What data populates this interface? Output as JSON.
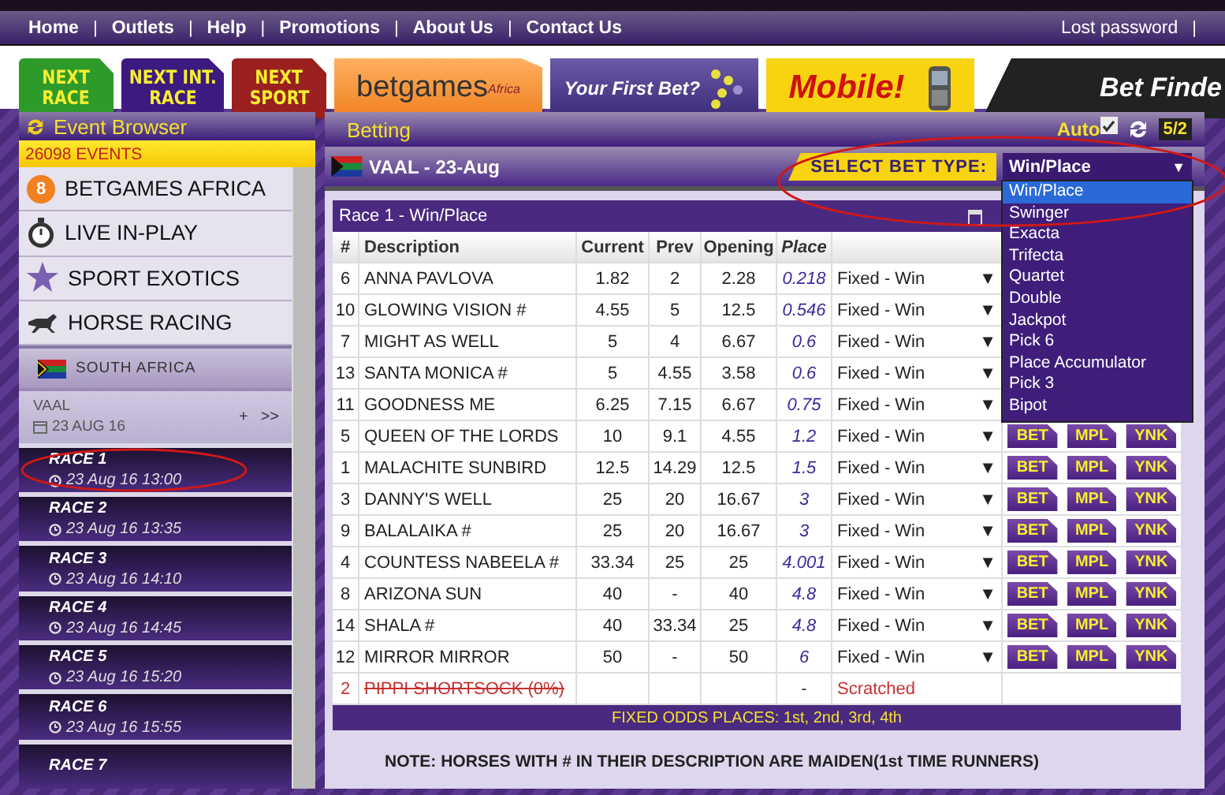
{
  "nav": {
    "links": [
      "Home",
      "Outlets",
      "Help",
      "Promotions",
      "About Us",
      "Contact Us"
    ],
    "separator": "|",
    "right_link": "Lost password"
  },
  "banners": [
    {
      "kind": "next",
      "lines": [
        "NEXT",
        "RACE"
      ],
      "color": "#2e9a2a"
    },
    {
      "kind": "next",
      "lines": [
        "NEXT INT.",
        "RACE"
      ],
      "color": "#3c1a80"
    },
    {
      "kind": "next",
      "lines": [
        "NEXT",
        "SPORT"
      ],
      "color": "#9a2020"
    },
    {
      "kind": "betgames",
      "lines": [
        "betgames",
        "Africa"
      ]
    },
    {
      "kind": "firstbet",
      "lines": [
        "Your First Bet?"
      ]
    },
    {
      "kind": "mobile",
      "lines": [
        "Mobile!"
      ]
    },
    {
      "kind": "finder",
      "lines": [
        "Bet Finde"
      ]
    }
  ],
  "sidebar": {
    "title": "Event Browser",
    "events": "26098 EVENTS",
    "categories": [
      {
        "label": "BETGAMES AFRICA",
        "kind": "ball",
        "badge": "8"
      },
      {
        "label": "LIVE IN-PLAY",
        "kind": "stopwatch"
      },
      {
        "label": "SPORT EXOTICS",
        "kind": "star"
      },
      {
        "label": "HORSE RACING",
        "kind": "horse"
      }
    ],
    "region": "SOUTH AFRICA",
    "meeting": {
      "name": "VAAL",
      "date": "23 AUG 16",
      "expand": "+",
      "go": ">>"
    },
    "races": [
      {
        "name": "RACE 1",
        "time": "23 Aug 16 13:00"
      },
      {
        "name": "RACE 2",
        "time": "23 Aug 16 13:35"
      },
      {
        "name": "RACE 3",
        "time": "23 Aug 16 14:10"
      },
      {
        "name": "RACE 4",
        "time": "23 Aug 16 14:45"
      },
      {
        "name": "RACE 5",
        "time": "23 Aug 16 15:20"
      },
      {
        "name": "RACE 6",
        "time": "23 Aug 16 15:55"
      },
      {
        "name": "RACE 7"
      }
    ]
  },
  "main": {
    "title": "Betting",
    "auto": {
      "label": "Auto",
      "checked": true
    },
    "odds_format": "5/2",
    "meeting": "VAAL - 23-Aug",
    "bet_type": {
      "label": "SELECT BET TYPE:",
      "value": "Win/Place",
      "arrow": "▼",
      "expanded": true,
      "options": [
        {
          "label": "Win/Place",
          "selected": true
        },
        {
          "label": "Swinger",
          "selected": false
        },
        {
          "label": "Exacta",
          "selected": false
        },
        {
          "label": "Trifecta",
          "selected": false
        },
        {
          "label": "Quartet",
          "selected": false
        },
        {
          "label": "Double",
          "selected": false
        },
        {
          "label": "Jackpot",
          "selected": false
        },
        {
          "label": "Pick 6",
          "selected": false
        },
        {
          "label": "Place Accumulator",
          "selected": false
        },
        {
          "label": "Pick 3",
          "selected": false
        },
        {
          "label": "Bipot",
          "selected": false
        }
      ]
    },
    "race_title": "Race 1 - Win/Place",
    "columns": [
      "#",
      "Description",
      "Current",
      "Prev",
      "Opening",
      "Place"
    ],
    "rows": [
      {
        "kind": "runner",
        "num": "6",
        "name": "ANNA PAVLOVA",
        "current": "1.82",
        "prev": "2",
        "opening": "2.28",
        "place": "0.218",
        "bet_type": "Fixed - Win",
        "arrow": "▼"
      },
      {
        "kind": "runner",
        "num": "10",
        "name": "GLOWING VISION #",
        "current": "4.55",
        "prev": "5",
        "opening": "12.5",
        "place": "0.546",
        "bet_type": "Fixed - Win",
        "arrow": "▼"
      },
      {
        "kind": "runner",
        "num": "7",
        "name": "MIGHT AS WELL",
        "current": "5",
        "prev": "4",
        "opening": "6.67",
        "place": "0.6",
        "bet_type": "Fixed - Win",
        "arrow": "▼"
      },
      {
        "kind": "runner",
        "num": "13",
        "name": "SANTA MONICA #",
        "current": "5",
        "prev": "4.55",
        "opening": "3.58",
        "place": "0.6",
        "bet_type": "Fixed - Win",
        "arrow": "▼"
      },
      {
        "kind": "runner",
        "num": "11",
        "name": "GOODNESS ME",
        "current": "6.25",
        "prev": "7.15",
        "opening": "6.67",
        "place": "0.75",
        "bet_type": "Fixed - Win",
        "arrow": "▼"
      },
      {
        "kind": "runner",
        "num": "5",
        "name": "QUEEN OF THE LORDS",
        "current": "10",
        "prev": "9.1",
        "opening": "4.55",
        "place": "1.2",
        "bet_type": "Fixed - Win",
        "arrow": "▼",
        "actions": [
          "BET",
          "MPL",
          "YNK"
        ]
      },
      {
        "kind": "runner",
        "num": "1",
        "name": "MALACHITE SUNBIRD",
        "current": "12.5",
        "prev": "14.29",
        "opening": "12.5",
        "place": "1.5",
        "bet_type": "Fixed - Win",
        "arrow": "▼",
        "actions": [
          "BET",
          "MPL",
          "YNK"
        ]
      },
      {
        "kind": "runner",
        "num": "3",
        "name": "DANNY'S WELL",
        "current": "25",
        "prev": "20",
        "opening": "16.67",
        "place": "3",
        "bet_type": "Fixed - Win",
        "arrow": "▼",
        "actions": [
          "BET",
          "MPL",
          "YNK"
        ]
      },
      {
        "kind": "runner",
        "num": "9",
        "name": "BALALAIKA #",
        "current": "25",
        "prev": "20",
        "opening": "16.67",
        "place": "3",
        "bet_type": "Fixed - Win",
        "arrow": "▼",
        "actions": [
          "BET",
          "MPL",
          "YNK"
        ]
      },
      {
        "kind": "runner",
        "num": "4",
        "name": "COUNTESS NABEELA #",
        "current": "33.34",
        "prev": "25",
        "opening": "25",
        "place": "4.001",
        "bet_type": "Fixed - Win",
        "arrow": "▼",
        "actions": [
          "BET",
          "MPL",
          "YNK"
        ]
      },
      {
        "kind": "runner",
        "num": "8",
        "name": "ARIZONA SUN",
        "current": "40",
        "prev": "-",
        "opening": "40",
        "place": "4.8",
        "bet_type": "Fixed - Win",
        "arrow": "▼",
        "actions": [
          "BET",
          "MPL",
          "YNK"
        ]
      },
      {
        "kind": "runner",
        "num": "14",
        "name": "SHALA #",
        "current": "40",
        "prev": "33.34",
        "opening": "25",
        "place": "4.8",
        "bet_type": "Fixed - Win",
        "arrow": "▼",
        "actions": [
          "BET",
          "MPL",
          "YNK"
        ]
      },
      {
        "kind": "runner",
        "num": "12",
        "name": "MIRROR MIRROR",
        "current": "50",
        "prev": "-",
        "opening": "50",
        "place": "6",
        "bet_type": "Fixed - Win",
        "arrow": "▼",
        "actions": [
          "BET",
          "MPL",
          "YNK"
        ]
      },
      {
        "kind": "scratched",
        "num": "2",
        "name": "PIPPI SHORTSOCK (0%)",
        "place": "-",
        "bet_type": "Scratched"
      }
    ],
    "footer": "FIXED ODDS PLACES: 1st, 2nd, 3rd, 4th",
    "note": "NOTE: HORSES WITH # IN THEIR DESCRIPTION ARE MAIDEN(1st TIME RUNNERS)"
  }
}
